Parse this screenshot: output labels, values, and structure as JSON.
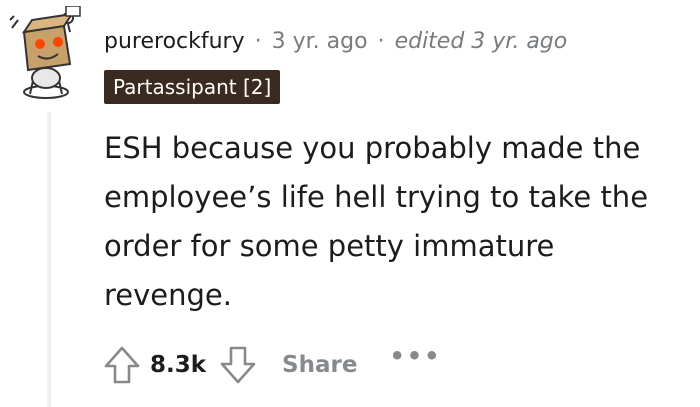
{
  "comment": {
    "avatar": "snoo-avatar-box-head",
    "username": "purerockfury",
    "separator": "·",
    "time": "3 yr. ago",
    "edited": "edited 3 yr. ago",
    "flair": "Partassipant [2]",
    "body": "ESH because you probably made the employee’s life hell trying to take the order for some petty immature revenge.",
    "score": "8.3k",
    "share_label": "Share",
    "more_label": "•••"
  },
  "colors": {
    "flair_bg": "#3a2a1f",
    "meta": "#787c7e",
    "action": "#878a8c"
  }
}
